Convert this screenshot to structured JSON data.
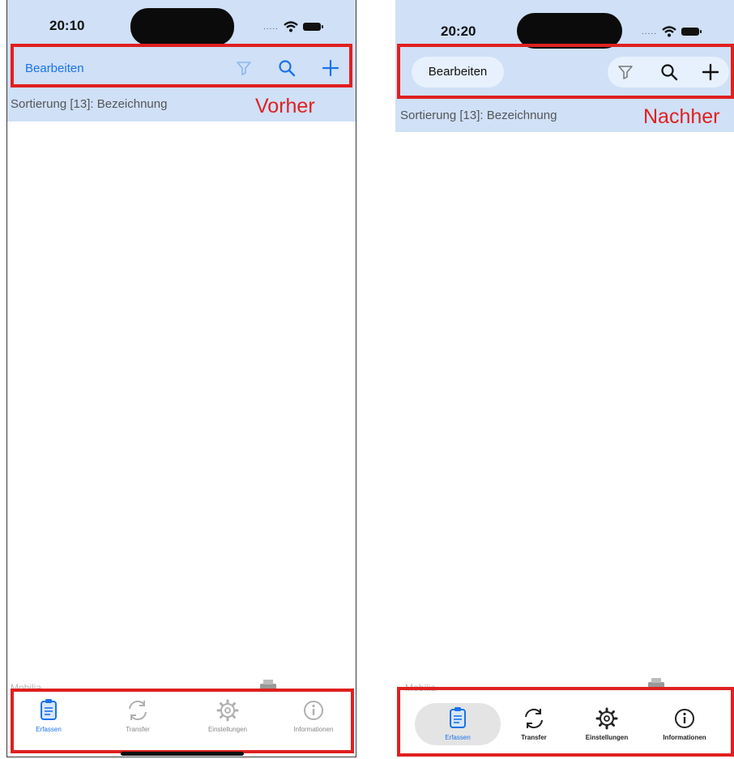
{
  "left": {
    "time": "20:10",
    "edit_label": "Bearbeiten",
    "sort_label": "Sortierung [13]: Bezeichnung",
    "annotation": "Vorher",
    "footer_faint": "Mobilia",
    "tabs": [
      {
        "label": "Erfassen",
        "icon": "clipboard-icon",
        "active": true
      },
      {
        "label": "Transfer",
        "icon": "sync-icon",
        "active": false
      },
      {
        "label": "Einstellungen",
        "icon": "gear-icon",
        "active": false
      },
      {
        "label": "Informationen",
        "icon": "info-icon",
        "active": false
      }
    ]
  },
  "right": {
    "time": "20:20",
    "edit_label": "Bearbeiten",
    "sort_label": "Sortierung [13]: Bezeichnung",
    "annotation": "Nachher",
    "footer_faint": "Mobilia",
    "tabs": [
      {
        "label": "Erfassen",
        "icon": "clipboard-icon",
        "active": true
      },
      {
        "label": "Transfer",
        "icon": "sync-icon",
        "active": false
      },
      {
        "label": "Einstellungen",
        "icon": "gear-icon",
        "active": false
      },
      {
        "label": "Informationen",
        "icon": "info-icon",
        "active": false
      }
    ]
  },
  "colors": {
    "header_bg": "#cfe0f7",
    "accent_blue": "#1a73e8",
    "highlight_red": "#e02020",
    "pill_bg": "#e7f1fd"
  },
  "status_bar": {
    "signal_dots": "....."
  }
}
